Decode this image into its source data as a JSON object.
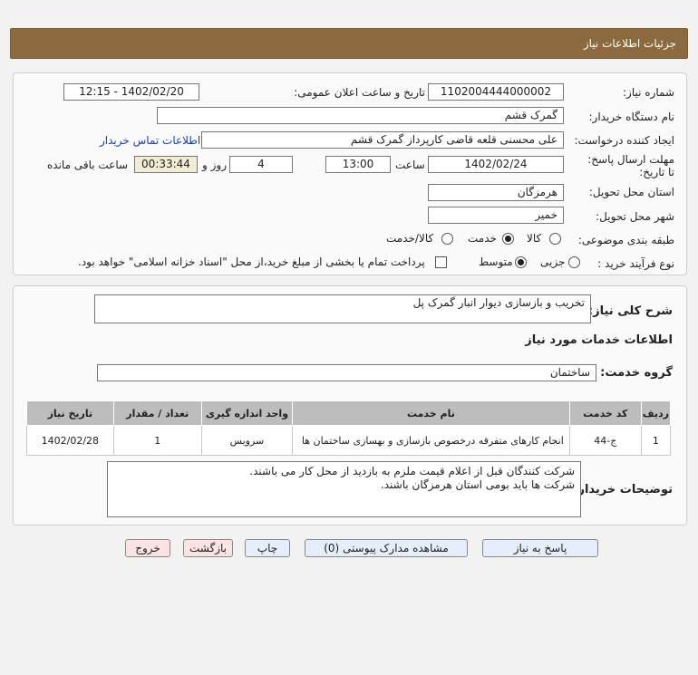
{
  "header": {
    "title": "جزئیات اطلاعات نیاز"
  },
  "form": {
    "need_number_label": "شماره نیاز:",
    "need_number": "1102004444000002",
    "announce_label": "تاریخ و ساعت اعلان عمومی:",
    "announce_value": "1402/02/20 - 12:15",
    "buyer_org_label": "نام دستگاه خریدار:",
    "buyer_org": "گمرک قشم",
    "creator_label": "ایجاد کننده درخواست:",
    "creator": "علی  محسنی قلعه قاضی کارپرداز گمرک قشم",
    "contact_link": "اطلاعات تماس خریدار",
    "deadline_label": "مهلت ارسال پاسخ: تا تاریخ:",
    "deadline_date": "1402/02/24",
    "time_label": "ساعت",
    "deadline_time": "13:00",
    "days_value": "4",
    "days_label": "روز و",
    "remaining_time": "00:33:44",
    "remaining_label": "ساعت باقی مانده",
    "province_label": "استان محل تحویل:",
    "province": "هرمزگان",
    "city_label": "شهر محل تحویل:",
    "city": "خمیر",
    "category_label": "طبقه بندی موضوعی:",
    "category_options": [
      "کالا",
      "خدمت",
      "کالا/خدمت"
    ],
    "category_selected": "خدمت",
    "process_label": "نوع فرآیند خرید :",
    "process_options": [
      "جزیی",
      "متوسط"
    ],
    "process_selected": "متوسط",
    "payment_note": "پرداخت تمام یا بخشی از مبلغ خرید،از محل \"اسناد خزانه اسلامی\" خواهد بود."
  },
  "summary": {
    "label": "شرح کلی نیاز:",
    "value": "تخریب و بازسازی دیوار انبار گمرک پل"
  },
  "services": {
    "section_title": "اطلاعات خدمات مورد نیاز",
    "group_label": "گروه خدمت:",
    "group_value": "ساختمان",
    "columns": [
      "ردیف",
      "کد خدمت",
      "نام خدمت",
      "واحد اندازه گیری",
      "تعداد / مقدار",
      "تاریخ نیاز"
    ],
    "rows": [
      [
        "1",
        "ج-44",
        "انجام کارهای متفرقه درخصوص بازسازی و بهسازی ساختمان ها",
        "سرویس",
        "1",
        "1402/02/28"
      ]
    ]
  },
  "buyer_notes": {
    "label": "توضیحات خریدار:",
    "line1": "شرکت کنندگان قبل از اعلام قیمت ملزم به بازدید از محل کار می باشند.",
    "line2": "شرکت ها باید بومی استان هرمزگان باشند."
  },
  "buttons": {
    "reply": "پاسخ به نیاز",
    "attachments": "مشاهده مدارک پیوستی (0)",
    "print": "چاپ",
    "back": "بازگشت",
    "exit": "خروج"
  }
}
